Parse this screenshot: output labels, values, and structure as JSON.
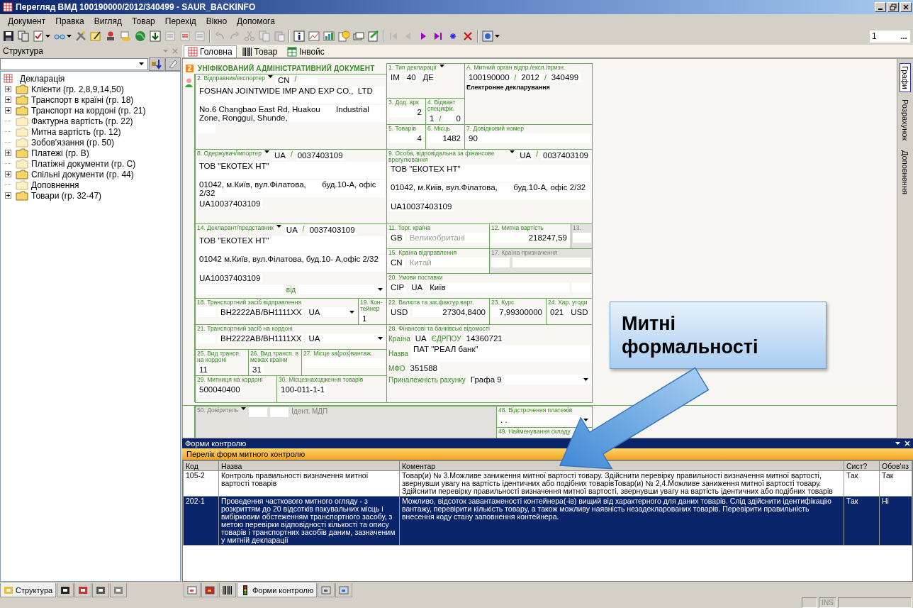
{
  "window": {
    "title": "Перегляд ВМД 100190000/2012/340499 - SAUR_BACKINFO"
  },
  "menu": [
    "Документ",
    "Правка",
    "Вигляд",
    "Товар",
    "Перехід",
    "Вікно",
    "Допомога"
  ],
  "toolbar": {
    "page_field": "1",
    "browse_button": "..."
  },
  "structure_panel": {
    "title": "Структура",
    "tree": {
      "label": "Декларація",
      "children": [
        {
          "label": "Клієнти (гр. 2,8,9,14,50)",
          "expanded": false
        },
        {
          "label": "Транспорт в країні (гр. 18)",
          "expanded": false
        },
        {
          "label": "Транспорт на кордоні (гр. 21)",
          "expanded": false
        },
        {
          "label": "Фактурна вартість (гр. 22)"
        },
        {
          "label": "Митна вартість (гр. 12)"
        },
        {
          "label": "Зобов'язання (гр. 50)"
        },
        {
          "label": "Платежі (гр. В)",
          "expanded": false
        },
        {
          "label": "Платіжні документи (гр. С)"
        },
        {
          "label": "Спільні документи (гр. 44)",
          "expanded": false
        },
        {
          "label": "Доповнення"
        },
        {
          "label": "Товари (гр. 32-47)",
          "expanded": false
        }
      ]
    },
    "tabs": [
      {
        "label": "Структура",
        "selected": true
      },
      {
        "selected": false
      },
      {
        "selected": false
      },
      {
        "selected": false
      },
      {
        "selected": false
      }
    ]
  },
  "tabs": [
    {
      "label": "Головна",
      "selected": true
    },
    {
      "label": "Товар",
      "selected": false
    },
    {
      "label": "Інвойс",
      "selected": false
    }
  ],
  "side_tabs": [
    {
      "label": "Графи",
      "selected": true
    },
    {
      "label": "Розрахунок",
      "selected": false
    },
    {
      "label": "Доповнення",
      "selected": false
    }
  ],
  "form": {
    "badge": "2",
    "title": "УНІФІКОВАНИЙ АДМІНІСТРАТИВНИЙ ДОКУМЕНТ",
    "boxes": [
      {
        "label": "1. Тип декларації",
        "head": [
          {
            "kind": "arrow"
          }
        ],
        "rows": [
          [
            {
              "kind": "field",
              "text": "IM"
            },
            {
              "kind": "field",
              "text": "40"
            },
            {
              "kind": "field",
              "text": "ДЕ"
            }
          ]
        ]
      },
      {
        "label": "А. Митний орган відпр./експ./призн.",
        "rows": [
          [
            {
              "kind": "field",
              "text": "100190000"
            },
            {
              "kind": "sep",
              "text": "/"
            },
            {
              "kind": "field",
              "text": "2012"
            },
            {
              "kind": "sep",
              "text": "/"
            },
            {
              "kind": "field",
              "text": "340499"
            }
          ],
          [
            {
              "kind": "note",
              "text": "Електронне декларування"
            }
          ]
        ]
      },
      {
        "label": "2. Відправник/експортер",
        "head": [
          {
            "kind": "arrow"
          },
          {
            "kind": "field",
            "text": "CN"
          },
          {
            "kind": "sep",
            "text": "/"
          },
          {
            "kind": "blank"
          }
        ],
        "rows": [
          [
            {
              "kind": "area",
              "text": "FOSHAN JOINTWIDE IMP AND EXP CO.,  LTD"
            }
          ],
          [
            {
              "kind": "area",
              "text": "No.6 Changbao East Rd, Huakou       Industrial Zone, Ronggui, Shunde,"
            }
          ],
          [
            {
              "kind": "blank"
            }
          ]
        ]
      },
      {
        "label": "3. Дод. арк",
        "rows": [
          [
            {
              "kind": "number",
              "text": "2"
            }
          ]
        ]
      },
      {
        "label": "4. Відвант специфік.",
        "rows": [
          [
            {
              "kind": "field",
              "text": "1"
            },
            {
              "kind": "sep",
              "text": "/"
            },
            {
              "kind": "number",
              "text": "0"
            }
          ]
        ]
      },
      {
        "label": "5. Товарів",
        "rows": [
          [
            {
              "kind": "number",
              "text": "4"
            }
          ]
        ]
      },
      {
        "label": "6. Місць",
        "rows": [
          [
            {
              "kind": "number",
              "text": "1482"
            }
          ]
        ]
      },
      {
        "label": "7. Довідковий номер",
        "rows": [
          [
            {
              "kind": "line",
              "text": "90"
            }
          ]
        ]
      },
      {
        "label": "8. Одержувач/імпортер",
        "head": [
          {
            "kind": "arrow"
          },
          {
            "kind": "field",
            "text": "UA"
          },
          {
            "kind": "sep",
            "text": "/"
          },
          {
            "kind": "field",
            "text": "0037403109"
          }
        ],
        "rows": [
          [
            {
              "kind": "area",
              "text": "ТОВ \"ЕКОТЕХ НТ\""
            }
          ],
          [
            {
              "kind": "area",
              "text": "01042, м.Київ, вул.Філатова,       буд.10-А, офіс 2/32"
            }
          ],
          [
            {
              "kind": "field",
              "text": "UA10037403109"
            }
          ]
        ]
      },
      {
        "label": "9. Особа, відповідальна за фінансове врегулювання",
        "head": [
          {
            "kind": "arrow"
          },
          {
            "kind": "field",
            "text": "UA"
          },
          {
            "kind": "sep",
            "text": "/"
          },
          {
            "kind": "field",
            "text": "0037403109"
          }
        ],
        "rows": [
          [
            {
              "kind": "area",
              "text": "ТОВ \"ЕКОТЕХ НТ\""
            }
          ],
          [
            {
              "kind": "area",
              "text": "01042, м.Київ, вул.Філатова,       буд.10-А, офіс 2/32"
            }
          ],
          [
            {
              "kind": "field",
              "text": "UA10037403109"
            }
          ]
        ]
      },
      {
        "label": "14. Декларант/представник",
        "head": [
          {
            "kind": "arrow"
          },
          {
            "kind": "field",
            "text": "UA"
          },
          {
            "kind": "sep",
            "text": "/"
          },
          {
            "kind": "field",
            "text": "0037403109"
          }
        ],
        "rows": [
          [
            {
              "kind": "area",
              "text": "ТОВ \"ЕКОТЕХ НТ\""
            }
          ],
          [
            {
              "kind": "area",
              "text": "01042 м.Київ, вул.Філатова, буд.10- А,офіс 2/32"
            }
          ],
          [
            {
              "kind": "field",
              "text": "UA10037403109"
            }
          ],
          [
            {
              "kind": "line"
            },
            {
              "kind": "caption",
              "text": "від"
            },
            {
              "kind": "select"
            }
          ]
        ]
      },
      {
        "label": "11. Торг. країна",
        "rows": [
          [
            {
              "kind": "field",
              "text": "GB"
            },
            {
              "kind": "dim",
              "text": "Великобритані"
            }
          ]
        ]
      },
      {
        "label": "12.  Митна вартість",
        "rows": [
          [
            {
              "kind": "number",
              "text": "218247,59"
            }
          ]
        ]
      },
      {
        "label": "13.",
        "disabled": true,
        "rows": [
          [
            {
              "kind": "blank"
            }
          ]
        ]
      },
      {
        "label": "15. Країна відправлення",
        "rows": [
          [
            {
              "kind": "field",
              "text": "CN"
            },
            {
              "kind": "dim",
              "text": "Китай"
            }
          ]
        ]
      },
      {
        "label": "17. Країна призначення",
        "disabled": true,
        "rows": [
          [
            {
              "kind": "blank"
            },
            {
              "kind": "line"
            }
          ]
        ]
      },
      {
        "label": "20. Умови поставки",
        "rows": [
          [
            {
              "kind": "field",
              "text": "CIP"
            },
            {
              "kind": "field",
              "text": "UA"
            },
            {
              "kind": "line",
              "text": "Київ"
            },
            {
              "kind": "blank"
            }
          ]
        ]
      },
      {
        "label": "18. Транспортний засіб відправлення",
        "rows": [
          [
            {
              "kind": "blank"
            },
            {
              "kind": "field",
              "text": "BH2222AB/BH1111XX"
            },
            {
              "kind": "select",
              "text": "UA"
            }
          ]
        ]
      },
      {
        "label": "19. Кон-тейнер",
        "rows": [
          [
            {
              "kind": "field",
              "text": "1"
            }
          ]
        ]
      },
      {
        "label": "22. Валюта та заг.фактур.варт.",
        "rows": [
          [
            {
              "kind": "field",
              "text": "USD"
            },
            {
              "kind": "number",
              "text": "27304,8400"
            }
          ]
        ]
      },
      {
        "label": "23. Курс",
        "rows": [
          [
            {
              "kind": "number",
              "text": "7,99300000"
            }
          ]
        ]
      },
      {
        "label": "24. Хар. угоди",
        "rows": [
          [
            {
              "kind": "field",
              "text": "021"
            },
            {
              "kind": "field",
              "text": "USD"
            }
          ]
        ]
      },
      {
        "label": "21. Транспортний засіб на кордоні",
        "rows": [
          [
            {
              "kind": "blank"
            },
            {
              "kind": "field",
              "text": "BH2222AB/BH1111XX"
            },
            {
              "kind": "select",
              "text": "UA"
            }
          ]
        ]
      },
      {
        "label": "28. Фінансові та банківські відомості",
        "rows": [
          [
            {
              "kind": "caption",
              "text": "Країна"
            },
            {
              "kind": "field",
              "text": "UA"
            },
            {
              "kind": "caption",
              "text": "ЄДРПОУ"
            },
            {
              "kind": "field",
              "text": "14360721"
            }
          ],
          [
            {
              "kind": "caption",
              "text": "Назва"
            },
            {
              "kind": "area",
              "text": "ПАТ \"РЕАЛ банк\""
            }
          ],
          [
            {
              "kind": "caption",
              "text": "МФО"
            },
            {
              "kind": "field",
              "text": "351588"
            }
          ],
          [
            {
              "kind": "caption",
              "text": "Приналежність рахунку"
            },
            {
              "kind": "select",
              "text": "Графа 9"
            }
          ]
        ]
      },
      {
        "label": "25. Вид трансп. на кордоні",
        "rows": [
          [
            {
              "kind": "field",
              "text": "11"
            }
          ]
        ]
      },
      {
        "label": "26. Вид трансп. в межах країни",
        "rows": [
          [
            {
              "kind": "field",
              "text": "31"
            }
          ]
        ]
      },
      {
        "label": "27. Місце за(роз)вантаж.",
        "rows": [
          [
            {
              "kind": "line"
            }
          ]
        ]
      },
      {
        "label": "29. Митниця на кордоні",
        "rows": [
          [
            {
              "kind": "field",
              "text": "500040400"
            }
          ]
        ]
      },
      {
        "label": "30. Місцезнаходження товарів",
        "rows": [
          [
            {
              "kind": "field",
              "text": "100-011-1-1"
            }
          ]
        ]
      }
    ],
    "lower_boxes": [
      {
        "label": "50. Довіритель",
        "disabled": true,
        "head": [
          {
            "kind": "arrow"
          },
          {
            "kind": "blank"
          },
          {
            "kind": "blank"
          },
          {
            "kind": "caption",
            "text": "Ідент. МДП"
          }
        ]
      },
      {
        "label": "48. Відстрочення платежів",
        "rows": [
          [
            {
              "kind": "select",
              "text": ". ."
            }
          ]
        ]
      },
      {
        "label": "49. Найменування складу"
      }
    ]
  },
  "control_panel": {
    "title": "Форми контролю",
    "subtitle": "Перелік форм митного контролю",
    "columns": [
      "Код",
      "Назва",
      "Коментар",
      "Сист?",
      "Обов'яз"
    ],
    "rows": [
      {
        "selected": false,
        "cells": [
          "105-2",
          "Контроль правильності визначення митної вартості товарів",
          "Товар(и) № 3.Можливе заниження митної вартості товару. Здійснити перевірку правильності визначення митної вартості, звернувши увагу на вартість ідентичних або подібних товарівТовар(и) № 2,4.Можливе заниження митної вартості товару. Здійснити перевірку правильності визначення митної вартості, звернувши увагу на вартість ідентичних або подібних товарів",
          "Так",
          "Так"
        ]
      },
      {
        "selected": true,
        "cells": [
          "202-1",
          "Проведення часткового митного огляду - з розкриттям до 20 відсотків пакувальних місць і вибірковим обстеженням транспортного засобу, з метою перевірки відповідності кількості та опису товарів і транспортних засобів даним, зазначеним у митній декларації",
          "Можливо, відсоток завантаженості контейнера(-ів) вищий від характерного для даних товарів. Слід здійснити ідентифікацію вантажу, перевірити кількість товару, а також можливу наявність незадекларованих товарів. Перевірити правильність внесення коду стану заповнення контейнера.",
          "Так",
          "Ні"
        ]
      }
    ],
    "tabs": [
      {
        "selected": false
      },
      {
        "selected": false
      },
      {
        "selected": false
      },
      {
        "label": "Форми контролю",
        "selected": true
      },
      {
        "selected": false
      },
      {
        "selected": false
      }
    ]
  },
  "status_bar": {
    "mode": "INS"
  },
  "callout": {
    "text": "Митні формальності"
  }
}
